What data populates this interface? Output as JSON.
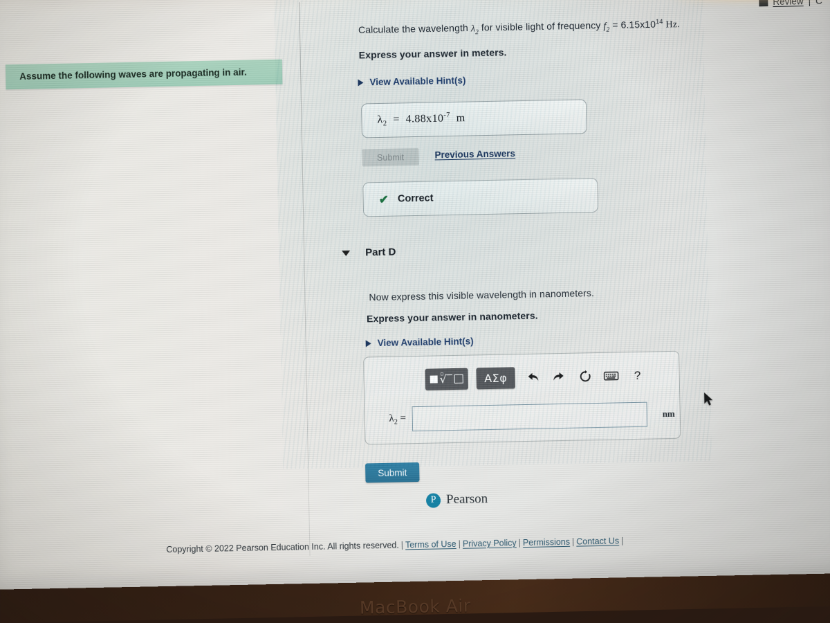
{
  "device": {
    "bezel_label": "MacBook Air"
  },
  "header": {
    "review_icon": "filled-square-icon",
    "review_label": "Review",
    "separator": "|",
    "truncated_next": "C"
  },
  "left_panel": {
    "assume_note": "Assume the following waves are propagating in air."
  },
  "part_c": {
    "prompt_prefix": "Calculate the wavelength ",
    "prompt_symbol": "λ",
    "prompt_symbol_sub": "2",
    "prompt_middle": " for visible light of frequency ",
    "freq_symbol": "f",
    "freq_symbol_sub": "2",
    "freq_equals": " = 6.15x10",
    "freq_exponent": "14",
    "freq_unit": "Hz",
    "prompt_suffix": ".",
    "express_instruction": "Express your answer in meters.",
    "hint_label": "View Available Hint(s)",
    "hint_icon": "triangle-right-icon",
    "answer_symbol": "λ",
    "answer_symbol_sub": "2",
    "answer_equals": "=",
    "answer_mantissa": "4.88x10",
    "answer_exponent": "-7",
    "answer_unit": "m",
    "submit_label": "Submit",
    "previous_answers_label": "Previous Answers",
    "feedback_icon": "check-icon",
    "feedback_label": "Correct"
  },
  "part_d": {
    "toggle_icon": "triangle-down-icon",
    "title": "Part D",
    "prompt": "Now express this visible wavelength in nanometers.",
    "express_instruction": "Express your answer in nanometers.",
    "hint_label": "View Available Hint(s)",
    "hint_icon": "triangle-right-icon",
    "math_toolbar": [
      {
        "name": "template-button",
        "label": "▢√▢"
      },
      {
        "name": "greek-symbols-button",
        "label": "ΑΣφ"
      },
      {
        "name": "undo-icon",
        "label": "↰"
      },
      {
        "name": "redo-icon",
        "label": "↱"
      },
      {
        "name": "reset-icon",
        "label": "↻"
      },
      {
        "name": "keyboard-icon",
        "label": "⌨"
      },
      {
        "name": "help-icon",
        "label": "?"
      }
    ],
    "answer_symbol": "λ",
    "answer_symbol_sub": "2",
    "answer_equals": "=",
    "answer_value": "",
    "answer_placeholder": "",
    "unit_label": "nm",
    "submit_label": "Submit"
  },
  "footer": {
    "brand_mark": "P",
    "brand_name": "Pearson",
    "copyright": "Copyright © 2022 Pearson Education Inc. All rights reserved.",
    "links": [
      "Terms of Use",
      "Privacy Policy",
      "Permissions",
      "Contact Us"
    ],
    "trailing_separator": "|"
  },
  "colors": {
    "accent_blue": "#2d7fa5",
    "link_navy": "#16325c",
    "correct_green": "#15703c",
    "note_green": "#a9d2bd",
    "pearson_teal": "#0f7fa3"
  }
}
